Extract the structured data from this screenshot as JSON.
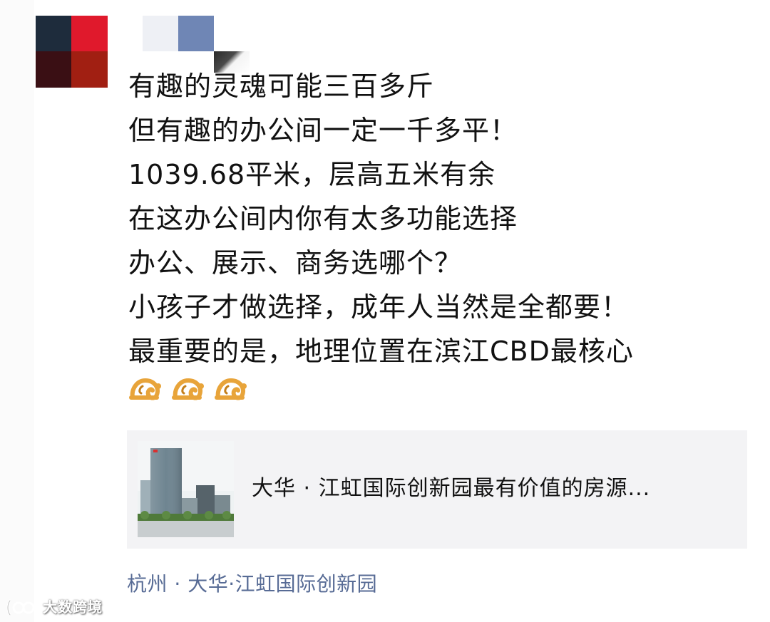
{
  "post": {
    "lines": [
      "有趣的灵魂可能三百多斤",
      "但有趣的办公间一定一千多平！",
      "1039.68平米，层高五米有余",
      "在这办公间内你有太多功能选择",
      "办公、展示、商务选哪个？",
      "小孩子才做选择，成年人当然是全都要！",
      "最重要的是，地理位置在滨江CBD最核心"
    ],
    "emojis": [
      "money-bag-icon",
      "money-bag-icon",
      "money-bag-icon"
    ]
  },
  "link_card": {
    "title": "大华 · 江虹国际创新园最有价值的房源..."
  },
  "location": {
    "text": "杭州 · 大华·江虹国际创新园"
  },
  "watermark": {
    "text": "大数跨境"
  },
  "colors": {
    "location_link": "#576b95",
    "card_background": "#f3f3f5",
    "emoji": "#e8a43a"
  }
}
